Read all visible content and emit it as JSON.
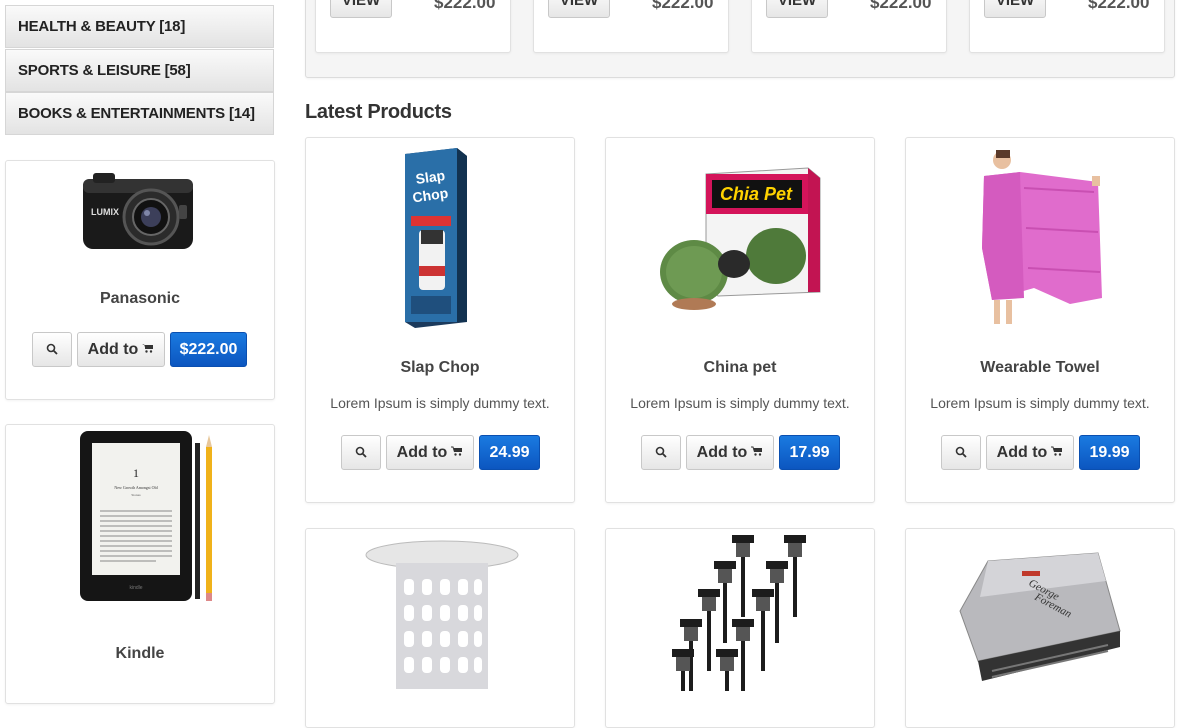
{
  "sidebar": {
    "categories": [
      {
        "label": "HEALTH & BEAUTY [18]"
      },
      {
        "label": "SPORTS & LEISURE [58]"
      },
      {
        "label": "BOOKS & ENTERTAINMENTS [14]"
      }
    ],
    "featured": [
      {
        "name": "Panasonic",
        "add_label": "Add to",
        "price": "$222.00"
      },
      {
        "name": "Kindle"
      }
    ]
  },
  "top_row": {
    "view_label": "VIEW",
    "prices": [
      "$222.00",
      "$222.00",
      "$222.00",
      "$222.00"
    ]
  },
  "latest": {
    "heading": "Latest Products",
    "products": [
      {
        "name": "Slap Chop",
        "desc": "Lorem Ipsum is simply dummy text.",
        "add_label": "Add to",
        "price": "24.99"
      },
      {
        "name": "China pet",
        "desc": "Lorem Ipsum is simply dummy text.",
        "add_label": "Add to",
        "price": "17.99"
      },
      {
        "name": "Wearable Towel",
        "desc": "Lorem Ipsum is simply dummy text.",
        "add_label": "Add to",
        "price": "19.99"
      }
    ],
    "second_row": [
      {
        "icon": "drain-stopper-image"
      },
      {
        "icon": "solar-lights-image"
      },
      {
        "icon": "grill-image"
      }
    ]
  },
  "colors": {
    "price_button": "#0c5fcf",
    "panel_border": "#e1e1e1",
    "category_bg": "#ececec"
  }
}
